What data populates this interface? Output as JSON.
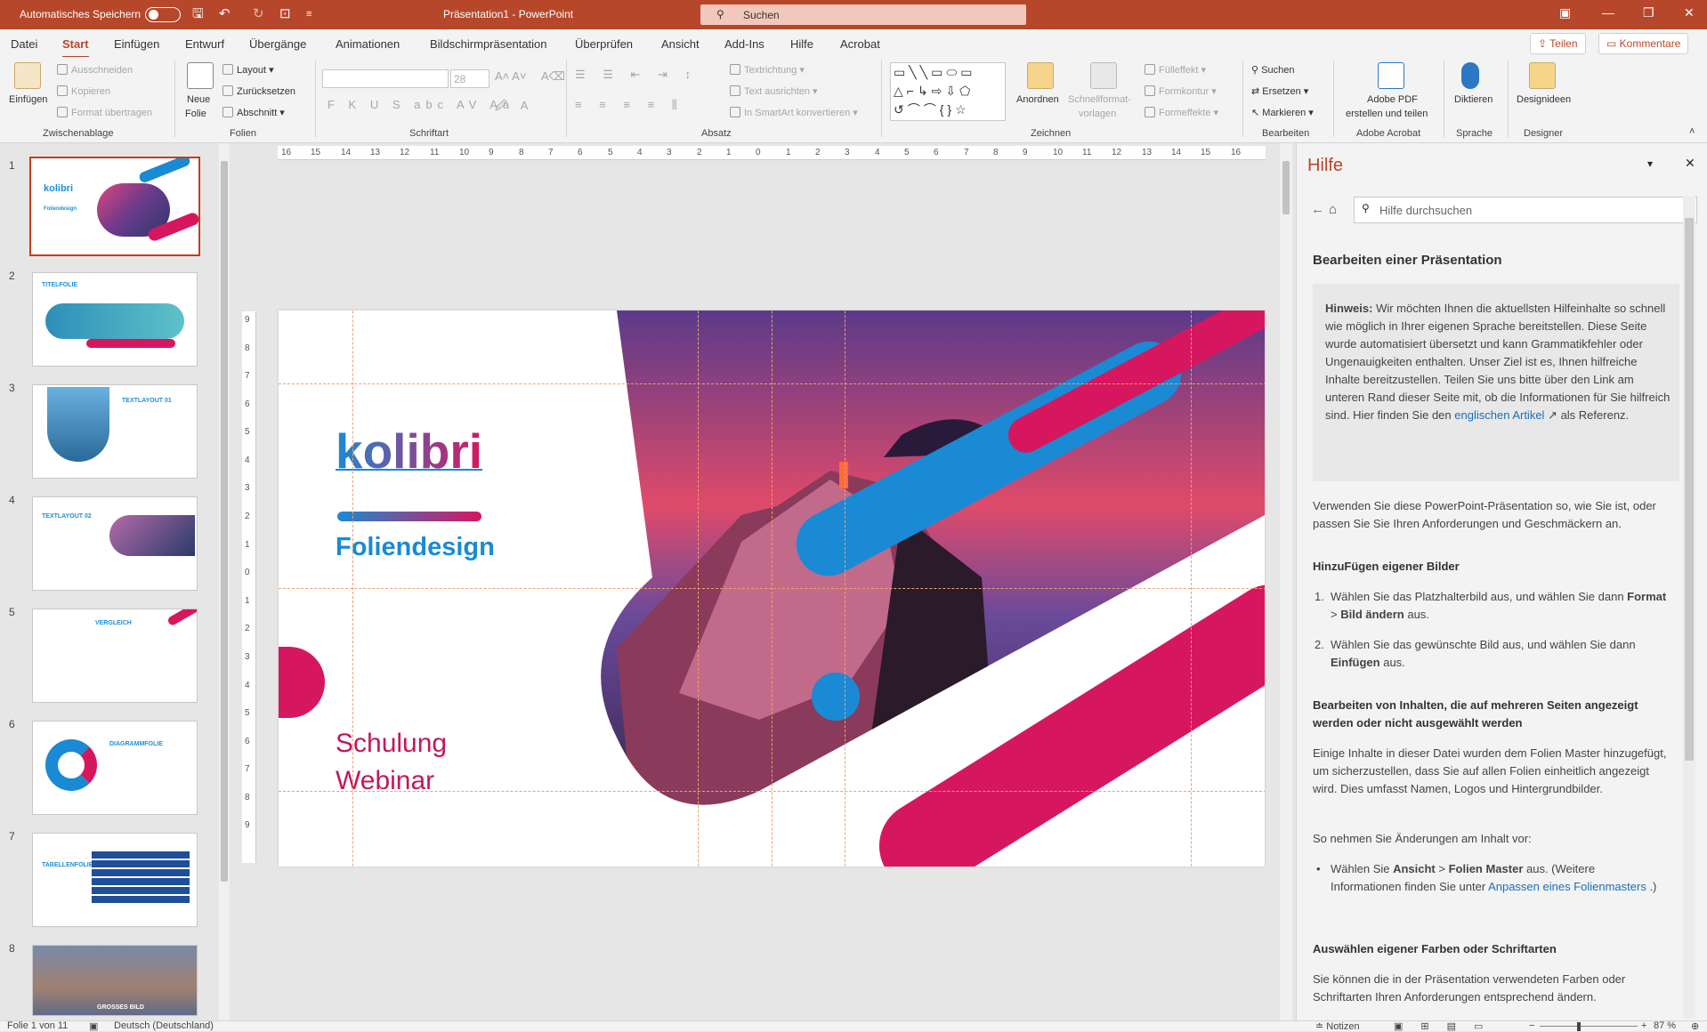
{
  "titlebar": {
    "autosave": "Automatisches Speichern",
    "doc_title": "Präsentation1  -  PowerPoint",
    "search": "Suchen"
  },
  "menu": {
    "tabs": [
      "Datei",
      "Start",
      "Einfügen",
      "Entwurf",
      "Übergänge",
      "Animationen",
      "Bildschirmpräsentation",
      "Überprüfen",
      "Ansicht",
      "Add-Ins",
      "Hilfe",
      "Acrobat"
    ],
    "share": "Teilen",
    "comments": "Kommentare"
  },
  "ribbon": {
    "clipboard": {
      "paste": "Einfügen",
      "cut": "Ausschneiden",
      "copy": "Kopieren",
      "format_painter": "Format übertragen",
      "label": "Zwischenablage"
    },
    "slides": {
      "new_slide_1": "Neue",
      "new_slide_2": "Folie",
      "layout": "Layout",
      "reset": "Zurücksetzen",
      "section": "Abschnitt",
      "label": "Folien"
    },
    "font": {
      "size": "28",
      "label": "Schriftart"
    },
    "paragraph": {
      "text_direction": "Textrichtung",
      "align_text": "Text ausrichten",
      "smartart": "In SmartArt konvertieren",
      "label": "Absatz"
    },
    "drawing": {
      "arrange": "Anordnen",
      "quick_styles_1": "Schnellformat-",
      "quick_styles_2": "vorlagen",
      "fill": "Fülleffekt",
      "outline": "Formkontur",
      "effects": "Formeffekte",
      "label": "Zeichnen"
    },
    "editing": {
      "find": "Suchen",
      "replace": "Ersetzen",
      "select": "Markieren",
      "label": "Bearbeiten"
    },
    "acrobat": {
      "create_1": "Adobe PDF",
      "create_2": "erstellen und teilen",
      "label": "Adobe Acrobat"
    },
    "voice": {
      "dictate": "Diktieren",
      "label": "Sprache"
    },
    "designer": {
      "ideas": "Designideen",
      "label": "Designer"
    }
  },
  "thumbnails": [
    {
      "n": "1",
      "title": "kolibri",
      "sub": "Foliendesign"
    },
    {
      "n": "2",
      "title": "TITELFOLIE"
    },
    {
      "n": "3",
      "title": "TEXTLAYOUT 01"
    },
    {
      "n": "4",
      "title": "TEXTLAYOUT 02"
    },
    {
      "n": "5",
      "title": "VERGLEICH"
    },
    {
      "n": "6",
      "title": "DIAGRAMMFOLIE"
    },
    {
      "n": "7",
      "title": "TABELLENFOLIE"
    },
    {
      "n": "8",
      "title": "GROSSES BILD"
    }
  ],
  "ruler_h": [
    "16",
    "15",
    "14",
    "13",
    "12",
    "11",
    "10",
    "9",
    "8",
    "7",
    "6",
    "5",
    "4",
    "3",
    "2",
    "1",
    "0",
    "1",
    "2",
    "3",
    "4",
    "5",
    "6",
    "7",
    "8",
    "9",
    "10",
    "11",
    "12",
    "13",
    "14",
    "15",
    "16"
  ],
  "ruler_v": [
    "9",
    "8",
    "7",
    "6",
    "5",
    "4",
    "3",
    "2",
    "1",
    "0",
    "1",
    "2",
    "3",
    "4",
    "5",
    "6",
    "7",
    "8",
    "9"
  ],
  "slide": {
    "brand": "kolibri",
    "subtitle": "Foliendesign",
    "line1": "Schulung",
    "line2": "Webinar"
  },
  "colors": {
    "accent": "#b7472a",
    "blue": "#1a8ad4",
    "pink": "#d6175f"
  },
  "help": {
    "title": "Hilfe",
    "search_placeholder": "Hilfe durchsuchen",
    "heading": "Bearbeiten einer Präsentation",
    "note_label": "Hinweis:",
    "note_text": " Wir möchten Ihnen die aktuellsten Hilfeinhalte so schnell wie möglich in Ihrer eigenen Sprache bereitstellen. Diese Seite wurde automatisiert übersetzt und kann Grammatikfehler oder Ungenauigkeiten enthalten. Unser Ziel ist es, Ihnen hilfreiche Inhalte bereitzustellen. Teilen Sie uns bitte über den Link am unteren Rand dieser Seite mit, ob die Informationen für Sie hilfreich sind. Hier finden Sie den ",
    "note_link": "englischen Artikel",
    "note_end": " als Referenz.",
    "intro": "Verwenden Sie diese PowerPoint-Präsentation so, wie Sie ist, oder passen Sie Sie Ihren Anforderungen und Geschmäckern an.",
    "h_images": "HinzuFügen eigener Bilder",
    "step1_a": "Wählen Sie das Platzhalterbild aus, und wählen Sie dann ",
    "step1_b": "Format",
    "step1_c": " > ",
    "step1_d": "Bild ändern",
    "step1_e": " aus.",
    "step2_a": "Wählen Sie das gewünschte Bild aus, und wählen Sie dann ",
    "step2_b": "Einfügen",
    "step2_c": " aus.",
    "h_master": "Bearbeiten von Inhalten, die auf mehreren Seiten angezeigt werden oder nicht ausgewählt werden",
    "master_p": "Einige Inhalte in dieser Datei wurden dem Folien Master hinzugefügt, um sicherzustellen, dass Sie auf allen Folien einheitlich angezeigt wird. Dies umfasst Namen, Logos und Hintergrundbilder.",
    "change_p": "So nehmen Sie Änderungen am Inhalt vor:",
    "bullet_a": "Wählen Sie ",
    "bullet_b": "Ansicht",
    "bullet_c": " > ",
    "bullet_d": "Folien Master",
    "bullet_e": " aus. (Weitere Informationen finden Sie unter ",
    "bullet_link": "Anpassen eines Folienmasters",
    "bullet_f": " .)",
    "h_colors": "Auswählen eigener Farben oder Schriftarten",
    "colors_p": "Sie können die in der Präsentation verwendeten Farben oder Schriftarten Ihren Anforderungen entsprechend ändern."
  },
  "status": {
    "slide": "Folie 1 von 11",
    "lang": "Deutsch (Deutschland)",
    "notes": "Notizen",
    "zoom": "87 %"
  }
}
